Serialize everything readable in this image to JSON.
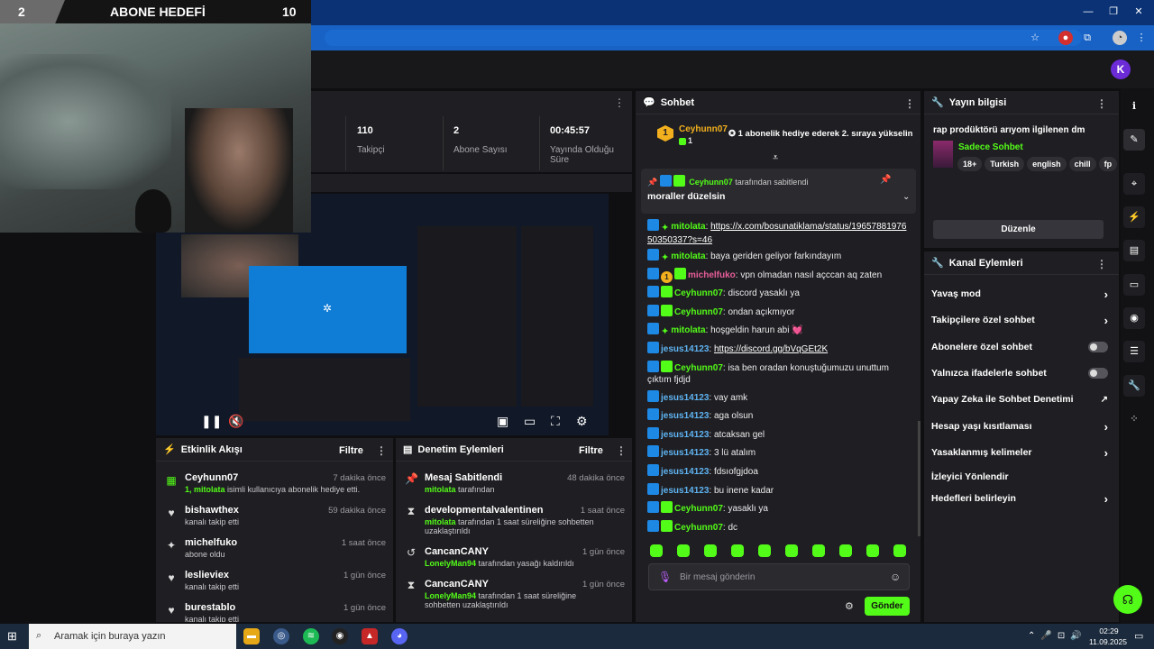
{
  "goal": {
    "left": "2",
    "title": "ABONE HEDEFİ",
    "right": "10"
  },
  "stats": [
    {
      "value": "110",
      "label": "Takipçi"
    },
    {
      "value": "2",
      "label": "Abone Sayısı"
    },
    {
      "value": "00:45:57",
      "label": "Yayında Olduğu Süre"
    }
  ],
  "event_feed": {
    "title": "Etkinlik Akışı",
    "filter": "Filtre",
    "items": [
      {
        "name": "Ceyhunn07",
        "time": "7 dakika önce",
        "sub_user": "1, mitolata",
        "sub": " isimli kullanıcıya abonelik hediye etti.",
        "icon": "gift-icon"
      },
      {
        "name": "bishawthex",
        "time": "59 dakika önce",
        "sub_user": "",
        "sub": "kanalı takip etti",
        "icon": "heart-icon"
      },
      {
        "name": "michelfuko",
        "time": "1 saat önce",
        "sub_user": "",
        "sub": "abone oldu",
        "icon": "sparkle-icon"
      },
      {
        "name": "leslieviex",
        "time": "1 gün önce",
        "sub_user": "",
        "sub": "kanalı takip etti",
        "icon": "heart-icon"
      },
      {
        "name": "burestablo",
        "time": "1 gün önce",
        "sub_user": "",
        "sub": "kanalı takip etti",
        "icon": "heart-icon"
      }
    ]
  },
  "mod_actions": {
    "title": "Denetim Eylemleri",
    "filter": "Filtre",
    "items": [
      {
        "name": "Mesaj Sabitlendi",
        "time": "48 dakika önce",
        "by": "mitolata",
        "rest": " tarafından",
        "icon": "pin-icon"
      },
      {
        "name": "developmentalvalentinen",
        "time": "1 saat önce",
        "by": "mitolata",
        "rest": " tarafından 1 saat süreliğine sohbetten uzaklaştırıldı",
        "icon": "hourglass-icon"
      },
      {
        "name": "CancanCANY",
        "time": "1 gün önce",
        "by": "LonelyMan94",
        "rest": " tarafından yasağı kaldırıldı",
        "icon": "undo-icon"
      },
      {
        "name": "CancanCANY",
        "time": "1 gün önce",
        "by": "LonelyMan94",
        "rest": " tarafından 1 saat süreliğine sohbetten uzaklaştırıldı",
        "icon": "hourglass-icon"
      }
    ]
  },
  "chat": {
    "title": "Sohbet",
    "top_gifter": {
      "name": "Ceyhunn07",
      "count": "1",
      "text": "1 abonelik hediye ederek 2. sıraya yükselin"
    },
    "pinned": {
      "by": "Ceyhunn07",
      "by_suffix": "tarafından sabitlendi",
      "text": "moraller düzelsin"
    },
    "messages": [
      {
        "user": "mitolata",
        "color": "#53fc18",
        "text": "",
        "link": "https://x.com/bosunatiklama/status/1965788197650350337?s=46",
        "badges": [
          "b-blue",
          "b-dia"
        ]
      },
      {
        "user": "mitolata",
        "color": "#53fc18",
        "text": "baya geriden geliyor farkındayım",
        "link": "",
        "badges": [
          "b-blue",
          "b-dia"
        ]
      },
      {
        "user": "michelfuko",
        "color": "#e85d9a",
        "text": "vpn olmadan nasıl açccan aq zaten",
        "link": "",
        "badges": [
          "b-blue",
          "b-one",
          "b-gift"
        ]
      },
      {
        "user": "Ceyhunn07",
        "color": "#53fc18",
        "text": "discord yasaklı ya",
        "link": "",
        "badges": [
          "b-blue",
          "b-gift"
        ]
      },
      {
        "user": "Ceyhunn07",
        "color": "#53fc18",
        "text": "ondan açıkmıyor",
        "link": "",
        "badges": [
          "b-blue",
          "b-gift"
        ]
      },
      {
        "user": "mitolata",
        "color": "#53fc18",
        "text": "hoşgeldin harun abi 💓",
        "link": "",
        "badges": [
          "b-blue",
          "b-dia"
        ]
      },
      {
        "user": "jesus14123",
        "color": "#5fb3f2",
        "text": "",
        "link": "https://discord.gg/bVqGEt2K",
        "badges": [
          "b-blue"
        ]
      },
      {
        "user": "Ceyhunn07",
        "color": "#53fc18",
        "text": "isa ben oradan konuştuğumuzu unuttum çıktım fjdjd",
        "link": "",
        "badges": [
          "b-blue",
          "b-gift"
        ]
      },
      {
        "user": "jesus14123",
        "color": "#5fb3f2",
        "text": "vay amk",
        "link": "",
        "badges": [
          "b-blue"
        ]
      },
      {
        "user": "jesus14123",
        "color": "#5fb3f2",
        "text": "aga olsun",
        "link": "",
        "badges": [
          "b-blue"
        ]
      },
      {
        "user": "jesus14123",
        "color": "#5fb3f2",
        "text": "atcaksan gel",
        "link": "",
        "badges": [
          "b-blue"
        ]
      },
      {
        "user": "jesus14123",
        "color": "#5fb3f2",
        "text": "3 lü atalım",
        "link": "",
        "badges": [
          "b-blue"
        ]
      },
      {
        "user": "jesus14123",
        "color": "#5fb3f2",
        "text": "fdsıofgjdoa",
        "link": "",
        "badges": [
          "b-blue"
        ]
      },
      {
        "user": "jesus14123",
        "color": "#5fb3f2",
        "text": "bu inene kadar",
        "link": "",
        "badges": [
          "b-blue"
        ]
      },
      {
        "user": "Ceyhunn07",
        "color": "#53fc18",
        "text": "yasaklı ya",
        "link": "",
        "badges": [
          "b-blue",
          "b-gift"
        ]
      },
      {
        "user": "Ceyhunn07",
        "color": "#53fc18",
        "text": "dc",
        "link": "",
        "badges": [
          "b-blue",
          "b-gift"
        ]
      }
    ],
    "input_placeholder": "Bir mesaj gönderin",
    "send": "Gönder"
  },
  "stream_info": {
    "title": "Yayın bilgisi",
    "stream_title": "rap prodüktörü arıyom ilgilenen dm",
    "category": "Sadece Sohbet",
    "tags": [
      "18+",
      "Turkish",
      "english",
      "chill",
      "fp"
    ],
    "edit": "Düzenle"
  },
  "channel_actions": {
    "title": "Kanal Eylemleri",
    "rows": [
      {
        "label": "Yavaş mod",
        "control": "chevron"
      },
      {
        "label": "Takipçilere özel sohbet",
        "control": "chevron"
      },
      {
        "label": "Abonelere özel sohbet",
        "control": "toggle"
      },
      {
        "label": "Yalnızca ifadelerle sohbet",
        "control": "toggle"
      },
      {
        "label": "Yapay Zeka ile Sohbet Denetimi",
        "control": "external"
      },
      {
        "label": "Hesap yaşı kısıtlaması",
        "control": "chevron"
      },
      {
        "label": "Yasaklanmış kelimeler",
        "control": "chevron"
      },
      {
        "label": "İzleyici Yönlendir",
        "control": "none"
      },
      {
        "label": "Hedefleri belirleyin",
        "control": "chevron"
      }
    ]
  },
  "taskbar": {
    "search": "Aramak için buraya yazın",
    "time": "02:29",
    "date": "11.09.2025"
  },
  "colors": {
    "accent": "#53fc18",
    "panel": "#1f1f23",
    "bg": "#0f0f12"
  }
}
